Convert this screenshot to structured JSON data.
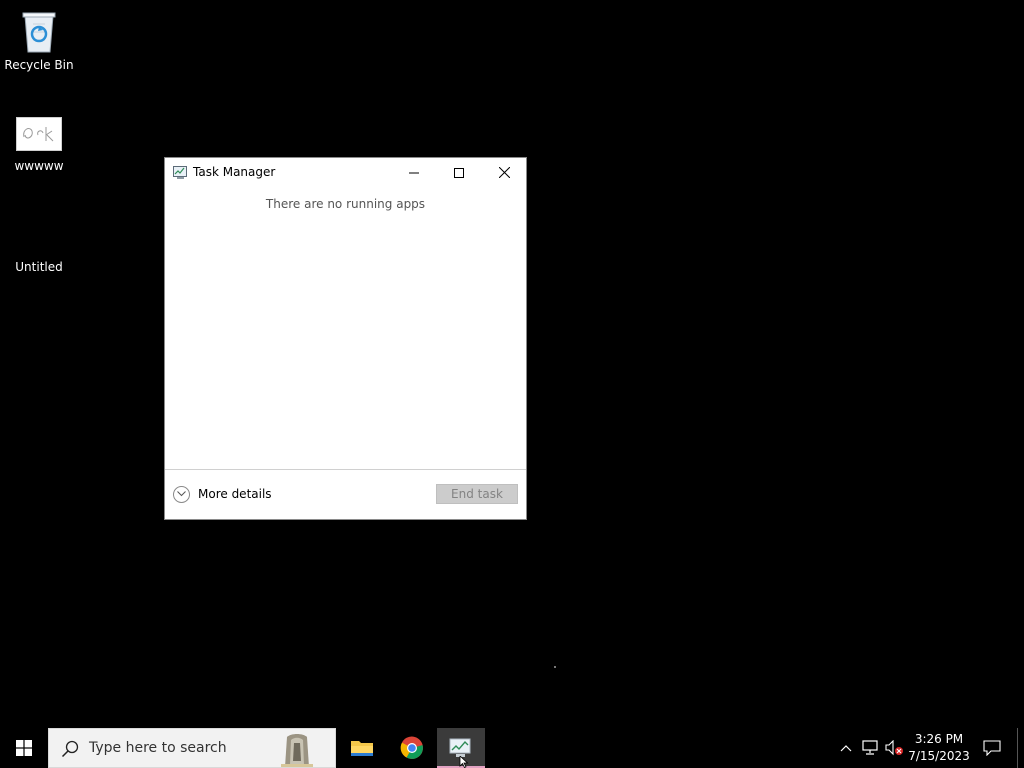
{
  "desktop": {
    "icons": [
      {
        "label": "Recycle Bin",
        "icon": "recycle-bin-icon"
      },
      {
        "label": "wwwww",
        "icon": "image-file-icon"
      },
      {
        "label": "Untitled",
        "icon": "blank-file-icon"
      }
    ]
  },
  "task_manager": {
    "title": "Task Manager",
    "empty_message": "There are no running apps",
    "more_details_label": "More details",
    "end_task_label": "End task",
    "end_task_enabled": false
  },
  "taskbar": {
    "search_placeholder": "Type here to search",
    "pinned_apps": [
      "file-explorer-icon",
      "chrome-icon",
      "task-manager-icon"
    ],
    "active_app": "Task Manager",
    "clock": {
      "time": "3:26 PM",
      "date": "7/15/2023"
    }
  },
  "colors": {
    "desktop_bg": "#000000",
    "taskbar_bg": "#000000",
    "search_bg": "#f2f2f2",
    "active_indicator": "#e2a1c2"
  }
}
